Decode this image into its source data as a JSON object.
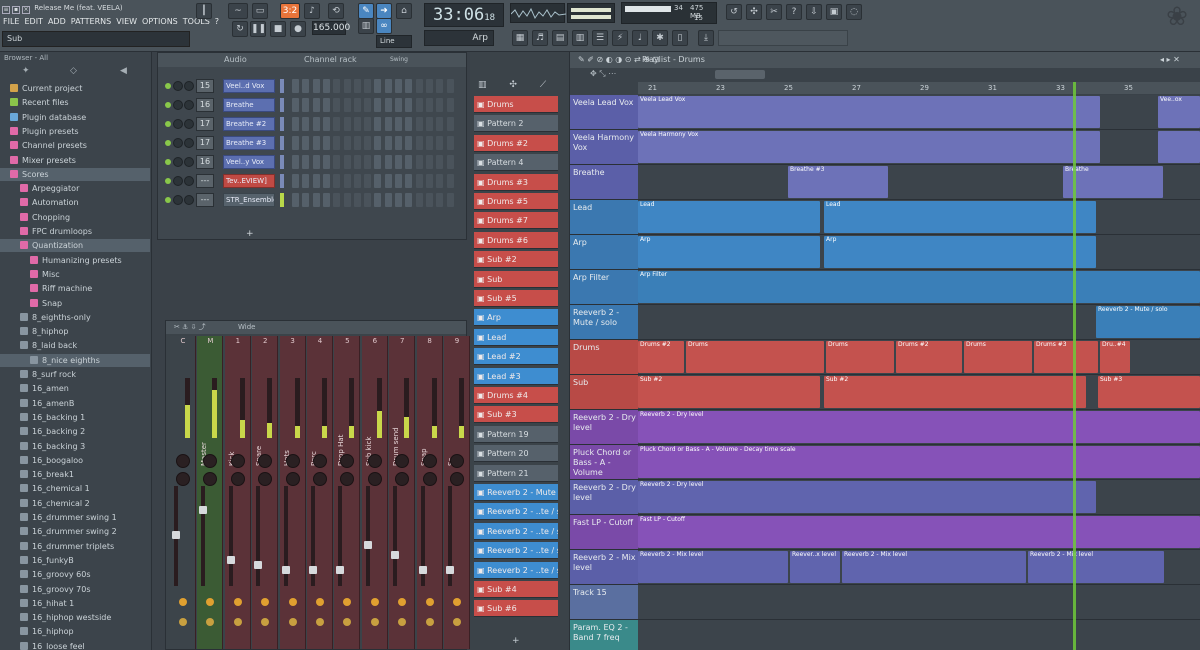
{
  "window": {
    "title": "Release Me (feat. VEELA)"
  },
  "menu": [
    "FILE",
    "EDIT",
    "ADD",
    "PATTERNS",
    "VIEW",
    "OPTIONS",
    "TOOLS",
    "?"
  ],
  "hint": "Sub",
  "transport": {
    "tempo": "165.000",
    "pat_num": "3:2",
    "time_main": "33:06",
    "time_sub": "18",
    "pattern": "Arp",
    "snap": "Line"
  },
  "cpu": {
    "value": "34",
    "mem": "475 MB",
    "poly": "15"
  },
  "browser": {
    "header": "Browser - All",
    "items": [
      {
        "label": "Current project",
        "color": "#d2a24a",
        "indent": 0
      },
      {
        "label": "Recent files",
        "color": "#8ac44a",
        "indent": 0
      },
      {
        "label": "Plugin database",
        "color": "#6aa8d8",
        "indent": 0
      },
      {
        "label": "Plugin presets",
        "color": "#e06aa8",
        "indent": 0
      },
      {
        "label": "Channel presets",
        "color": "#e06aa8",
        "indent": 0
      },
      {
        "label": "Mixer presets",
        "color": "#e06aa8",
        "indent": 0
      },
      {
        "label": "Scores",
        "color": "#e06aa8",
        "indent": 0,
        "sel": true
      },
      {
        "label": "Arpeggiator",
        "color": "#e06aa8",
        "indent": 1
      },
      {
        "label": "Automation",
        "color": "#e06aa8",
        "indent": 1
      },
      {
        "label": "Chopping",
        "color": "#e06aa8",
        "indent": 1
      },
      {
        "label": "FPC drumloops",
        "color": "#e06aa8",
        "indent": 1
      },
      {
        "label": "Quantization",
        "color": "#e06aa8",
        "indent": 1,
        "sel": true
      },
      {
        "label": "Humanizing presets",
        "color": "#e06aa8",
        "indent": 2
      },
      {
        "label": "Misc",
        "color": "#e06aa8",
        "indent": 2
      },
      {
        "label": "Riff machine",
        "color": "#e06aa8",
        "indent": 2
      },
      {
        "label": "Snap",
        "color": "#e06aa8",
        "indent": 2
      },
      {
        "label": "8_eighths-only",
        "color": "#8895a0",
        "indent": 1
      },
      {
        "label": "8_hiphop",
        "color": "#8895a0",
        "indent": 1
      },
      {
        "label": "8_laid back",
        "color": "#8895a0",
        "indent": 1
      },
      {
        "label": "8_nice eighths",
        "color": "#8895a0",
        "indent": 2,
        "sel": true
      },
      {
        "label": "8_surf rock",
        "color": "#8895a0",
        "indent": 1
      },
      {
        "label": "16_amen",
        "color": "#8895a0",
        "indent": 1
      },
      {
        "label": "16_amenB",
        "color": "#8895a0",
        "indent": 1
      },
      {
        "label": "16_backing 1",
        "color": "#8895a0",
        "indent": 1
      },
      {
        "label": "16_backing 2",
        "color": "#8895a0",
        "indent": 1
      },
      {
        "label": "16_backing 3",
        "color": "#8895a0",
        "indent": 1
      },
      {
        "label": "16_boogaloo",
        "color": "#8895a0",
        "indent": 1
      },
      {
        "label": "16_break1",
        "color": "#8895a0",
        "indent": 1
      },
      {
        "label": "16_chemical 1",
        "color": "#8895a0",
        "indent": 1
      },
      {
        "label": "16_chemical 2",
        "color": "#8895a0",
        "indent": 1
      },
      {
        "label": "16_drummer swing 1",
        "color": "#8895a0",
        "indent": 1
      },
      {
        "label": "16_drummer swing 2",
        "color": "#8895a0",
        "indent": 1
      },
      {
        "label": "16_drummer triplets",
        "color": "#8895a0",
        "indent": 1
      },
      {
        "label": "16_funkyB",
        "color": "#8895a0",
        "indent": 1
      },
      {
        "label": "16_groovy 60s",
        "color": "#8895a0",
        "indent": 1
      },
      {
        "label": "16_groovy 70s",
        "color": "#8895a0",
        "indent": 1
      },
      {
        "label": "16_hihat 1",
        "color": "#8895a0",
        "indent": 1
      },
      {
        "label": "16_hiphop westside",
        "color": "#8895a0",
        "indent": 1
      },
      {
        "label": "16_hiphop",
        "color": "#8895a0",
        "indent": 1
      },
      {
        "label": "16_loose feel",
        "color": "#8895a0",
        "indent": 1
      }
    ]
  },
  "rack": {
    "title": "Channel rack",
    "filter": "Audio",
    "swing": "Swing",
    "channels": [
      {
        "num": "15",
        "name": "Veel..d Vox",
        "color": "blue"
      },
      {
        "num": "16",
        "name": "Breathe",
        "color": "blue"
      },
      {
        "num": "17",
        "name": "Breathe #2",
        "color": "blue"
      },
      {
        "num": "17",
        "name": "Breathe #3",
        "color": "blue"
      },
      {
        "num": "16",
        "name": "Veel..y Vox",
        "color": "blue"
      },
      {
        "num": "---",
        "name": "Tev..EVIEW]",
        "color": "red"
      },
      {
        "num": "---",
        "name": "STR_Ensemble",
        "color": "gray"
      }
    ]
  },
  "mixer": {
    "title": "Wide",
    "strips": [
      {
        "num": "C",
        "label": "",
        "type": "cur",
        "level": 0.55
      },
      {
        "num": "M",
        "label": "Master",
        "type": "master",
        "level": 0.8
      },
      {
        "num": "1",
        "label": "Kick",
        "type": "ins",
        "level": 0.3
      },
      {
        "num": "2",
        "label": "Snare",
        "type": "ins",
        "level": 0.25
      },
      {
        "num": "3",
        "label": "Hats",
        "type": "ins",
        "level": 0.2
      },
      {
        "num": "4",
        "label": "Perc",
        "type": "ins",
        "level": 0.2
      },
      {
        "num": "5",
        "label": "Drop Hat",
        "type": "ins",
        "level": 0.2
      },
      {
        "num": "6",
        "label": "Sub kick",
        "type": "ins",
        "level": 0.45
      },
      {
        "num": "7",
        "label": "Drum send",
        "type": "ins",
        "level": 0.35
      },
      {
        "num": "8",
        "label": "Snap",
        "type": "ins",
        "level": 0.2
      },
      {
        "num": "9",
        "label": "Sc",
        "type": "ins",
        "level": 0.2
      }
    ]
  },
  "patterns": [
    {
      "label": "Drums",
      "color": "red"
    },
    {
      "label": "Pattern 2",
      "color": "gray"
    },
    {
      "label": "Drums #2",
      "color": "red"
    },
    {
      "label": "Pattern 4",
      "color": "gray"
    },
    {
      "label": "Drums #3",
      "color": "red"
    },
    {
      "label": "Drums #5",
      "color": "red"
    },
    {
      "label": "Drums #7",
      "color": "red"
    },
    {
      "label": "Drums #6",
      "color": "red"
    },
    {
      "label": "Sub #2",
      "color": "red"
    },
    {
      "label": "Sub",
      "color": "red"
    },
    {
      "label": "Sub #5",
      "color": "red"
    },
    {
      "label": "Arp",
      "color": "blue"
    },
    {
      "label": "Lead",
      "color": "blue"
    },
    {
      "label": "Lead #2",
      "color": "blue"
    },
    {
      "label": "Lead #3",
      "color": "blue"
    },
    {
      "label": "Drums #4",
      "color": "red"
    },
    {
      "label": "Sub #3",
      "color": "red"
    },
    {
      "label": "Pattern 19",
      "color": "gray"
    },
    {
      "label": "Pattern 20",
      "color": "gray"
    },
    {
      "label": "Pattern 21",
      "color": "gray"
    },
    {
      "label": "Reeverb 2 - Mute / solo",
      "color": "blue"
    },
    {
      "label": "Reeverb 2 - ..te / solo #4",
      "color": "blue"
    },
    {
      "label": "Reeverb 2 - ..te / solo #5",
      "color": "blue"
    },
    {
      "label": "Reeverb 2 - ..te / solo #2",
      "color": "blue"
    },
    {
      "label": "Reeverb 2 - ..te / solo #3",
      "color": "blue"
    },
    {
      "label": "Sub #4",
      "color": "red"
    },
    {
      "label": "Sub #6",
      "color": "red"
    }
  ],
  "playlist": {
    "title": "Playlist - Drums",
    "ruler": [
      "21",
      "23",
      "25",
      "27",
      "29",
      "31",
      "33",
      "35"
    ],
    "tracks": [
      {
        "name": "Veela Lead Vox",
        "color": "#5b5fa8",
        "clipcolor": "#6d72b8",
        "clips": [
          {
            "l": 0,
            "w": 462,
            "t": "Veela Lead Vox"
          },
          {
            "l": 520,
            "w": 42,
            "t": "Vee..ox"
          }
        ]
      },
      {
        "name": "Veela Harmony Vox",
        "color": "#5b5fa8",
        "clipcolor": "#6d72b8",
        "clips": [
          {
            "l": 0,
            "w": 462,
            "t": "Veela Harmony Vox"
          },
          {
            "l": 520,
            "w": 42,
            "t": ""
          }
        ]
      },
      {
        "name": "Breathe",
        "color": "#5b5fa8",
        "clipcolor": "#6d72b8",
        "clips": [
          {
            "l": 150,
            "w": 100,
            "t": "Breathe #3"
          },
          {
            "l": 425,
            "w": 100,
            "t": "Breathe"
          }
        ]
      },
      {
        "name": "Lead",
        "color": "#3b78b0",
        "clipcolor": "#3f86c4",
        "clips": [
          {
            "l": 0,
            "w": 182,
            "t": "Lead"
          },
          {
            "l": 186,
            "w": 272,
            "t": "Lead"
          }
        ]
      },
      {
        "name": "Arp",
        "color": "#3b78b0",
        "clipcolor": "#3f86c4",
        "clips": [
          {
            "l": 0,
            "w": 182,
            "t": "Arp"
          },
          {
            "l": 186,
            "w": 272,
            "t": "Arp"
          }
        ]
      },
      {
        "name": "Arp Filter",
        "color": "#3b78b0",
        "clipcolor": "#3a7fb8",
        "clips": [
          {
            "l": 0,
            "w": 562,
            "t": "Arp Filter"
          }
        ]
      },
      {
        "name": "Reeverb 2 - Mute / solo",
        "color": "#3b78b0",
        "clipcolor": "#3a7fb8",
        "clips": [
          {
            "l": 458,
            "w": 104,
            "t": "Reeverb 2 - Mute / solo"
          }
        ]
      },
      {
        "name": "Drums",
        "color": "#b84a46",
        "clipcolor": "#c4524e",
        "clips": [
          {
            "l": 0,
            "w": 46,
            "t": "Drums #2"
          },
          {
            "l": 48,
            "w": 138,
            "t": "Drums"
          },
          {
            "l": 188,
            "w": 68,
            "t": "Drums"
          },
          {
            "l": 258,
            "w": 66,
            "t": "Drums #2"
          },
          {
            "l": 326,
            "w": 68,
            "t": "Drums"
          },
          {
            "l": 396,
            "w": 64,
            "t": "Drums #3"
          },
          {
            "l": 462,
            "w": 30,
            "t": "Dru..#4"
          }
        ]
      },
      {
        "name": "Sub",
        "color": "#b84a46",
        "clipcolor": "#c4524e",
        "clips": [
          {
            "l": 0,
            "w": 182,
            "t": "Sub #2"
          },
          {
            "l": 186,
            "w": 262,
            "t": "Sub #2"
          },
          {
            "l": 460,
            "w": 102,
            "t": "Sub #3"
          }
        ]
      },
      {
        "name": "Reeverb 2 - Dry level",
        "color": "#7a4aa8",
        "clipcolor": "#8652b8",
        "clips": [
          {
            "l": 0,
            "w": 562,
            "t": "Reeverb 2 - Dry level"
          }
        ]
      },
      {
        "name": "Pluck Chord or Bass - A - Volume",
        "color": "#7a4aa8",
        "clipcolor": "#8652b8",
        "clips": [
          {
            "l": 0,
            "w": 562,
            "t": "Pluck Chord or Bass - A - Volume - Decay time scale"
          }
        ]
      },
      {
        "name": "Reeverb 2 - Dry level",
        "color": "#5b5fa8",
        "clipcolor": "#6064ae",
        "clips": [
          {
            "l": 0,
            "w": 458,
            "t": "Reeverb 2 - Dry level"
          }
        ]
      },
      {
        "name": "Fast LP - Cutoff",
        "color": "#7a4aa8",
        "clipcolor": "#8652b8",
        "clips": [
          {
            "l": 0,
            "w": 562,
            "t": "Fast LP - Cutoff"
          }
        ]
      },
      {
        "name": "Reeverb 2 - Mix level",
        "color": "#5b5fa8",
        "clipcolor": "#6064ae",
        "clips": [
          {
            "l": 0,
            "w": 150,
            "t": "Reeverb 2 - Mix level"
          },
          {
            "l": 152,
            "w": 50,
            "t": "Reever..x level"
          },
          {
            "l": 204,
            "w": 184,
            "t": "Reeverb 2 - Mix level"
          },
          {
            "l": 390,
            "w": 136,
            "t": "Reeverb 2 - Mix level"
          }
        ]
      },
      {
        "name": "Track 15",
        "color": "#5a6fa0",
        "clipcolor": "#5a6fa0",
        "clips": []
      },
      {
        "name": "Param. EQ 2 - Band 7 freq",
        "color": "#3a8a8a",
        "clipcolor": "#3a8a8a",
        "clips": []
      }
    ]
  }
}
